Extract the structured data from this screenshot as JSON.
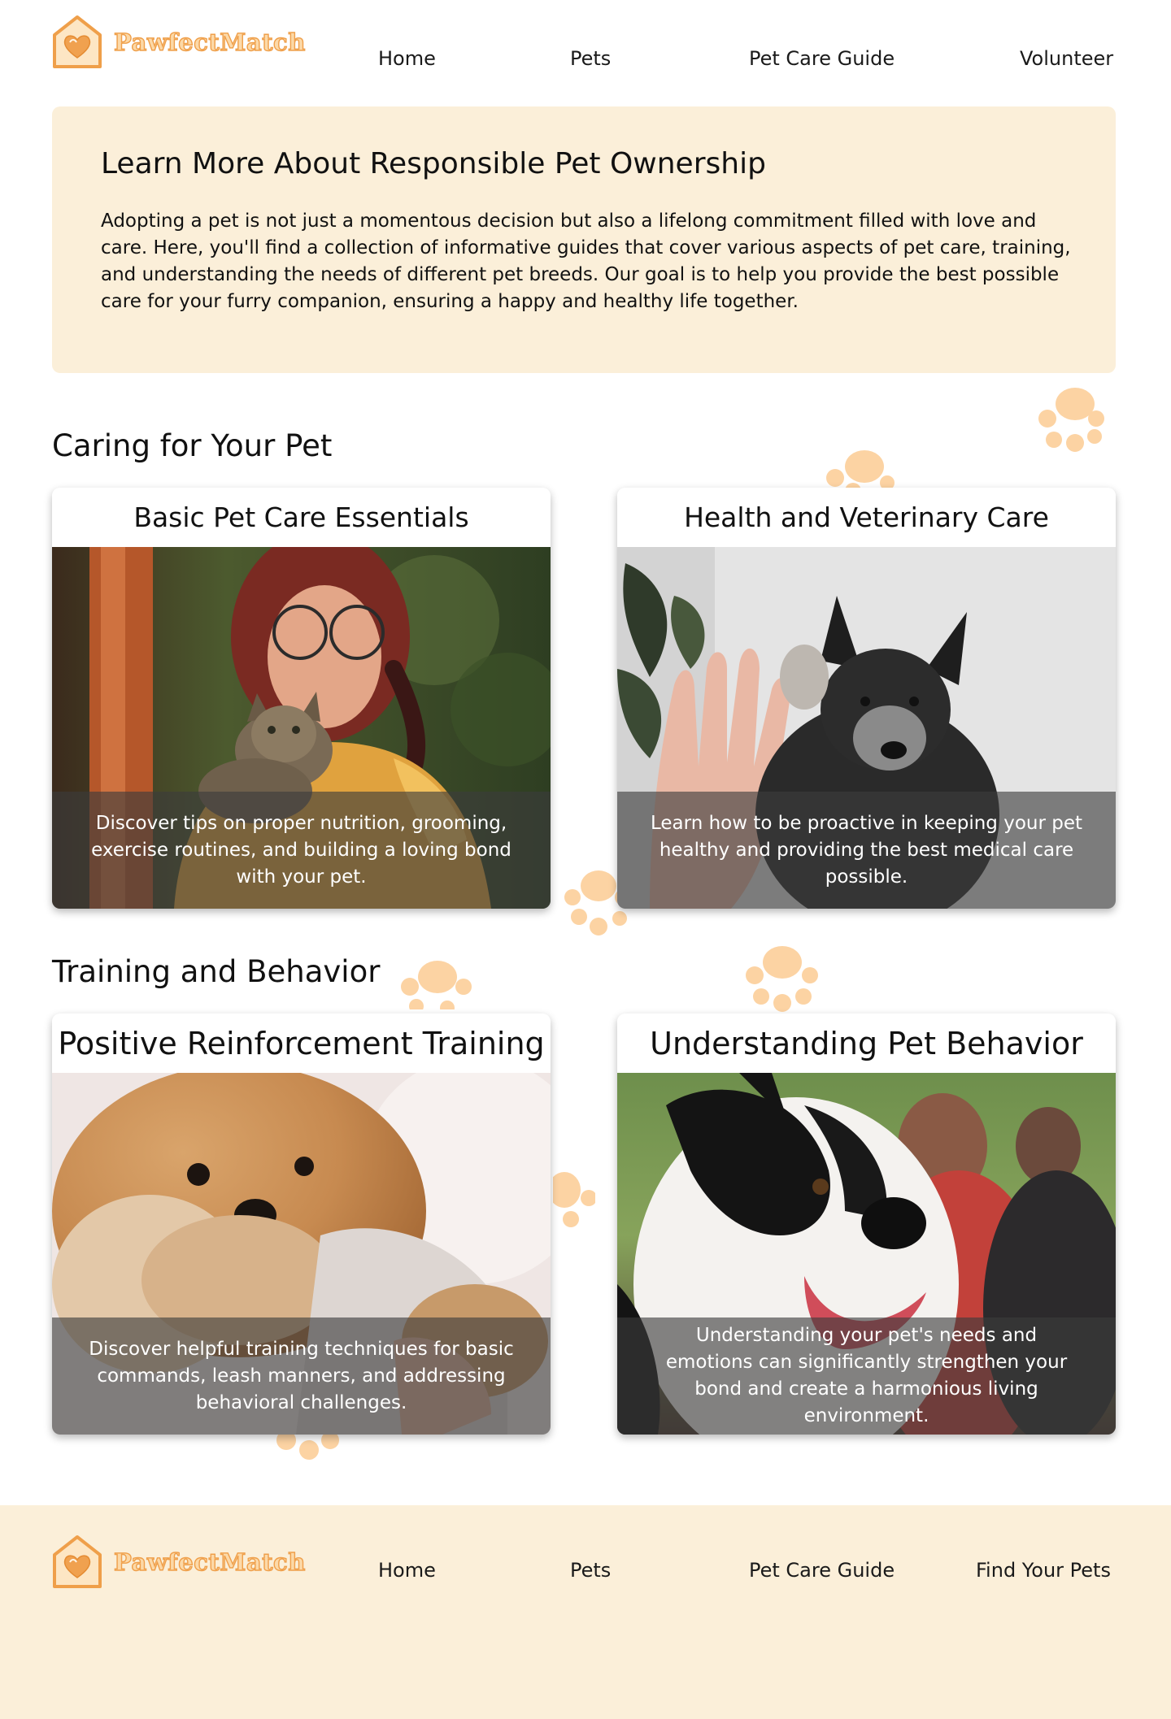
{
  "brand": {
    "name": "PawfectMatch"
  },
  "header": {
    "nav": [
      {
        "label": "Home"
      },
      {
        "label": "Pets"
      },
      {
        "label": "Pet Care Guide"
      },
      {
        "label": "Volunteer"
      }
    ]
  },
  "intro": {
    "title": "Learn More About Responsible Pet Ownership",
    "text": "Adopting a pet is not just a momentous decision but also a lifelong commitment filled with love and care. Here, you'll find a collection of informative guides that cover various aspects of pet care, training, and understanding the needs of different pet breeds. Our goal is to help you provide the best possible care for your furry companion, ensuring a happy and healthy life together."
  },
  "sections": [
    {
      "title": "Caring for Your Pet",
      "cards": [
        {
          "title": "Basic Pet Care Essentials",
          "caption": "Discover tips on proper nutrition, grooming, exercise routines, and building a loving bond with your pet."
        },
        {
          "title": "Health and Veterinary Care",
          "caption": "Learn how to be proactive in keeping your pet healthy and providing the best medical care possible."
        }
      ]
    },
    {
      "title": "Training and Behavior",
      "cards": [
        {
          "title": "Positive Reinforcement Training",
          "caption": "Discover helpful training techniques for basic commands, leash manners, and addressing behavioral challenges."
        },
        {
          "title": "Understanding Pet Behavior",
          "caption": "Understanding your pet's needs and emotions can significantly strengthen your bond and create a harmonious living environment."
        }
      ]
    }
  ],
  "footer": {
    "nav": [
      {
        "label": "Home"
      },
      {
        "label": "Pets"
      },
      {
        "label": "Pet Care Guide"
      },
      {
        "label": "Find Your Pets"
      }
    ]
  },
  "colors": {
    "accent": "#ef9f4a",
    "accent_light": "#fcd9a8",
    "panel_bg": "#fbefd9",
    "paw": "#fcd3a3"
  }
}
